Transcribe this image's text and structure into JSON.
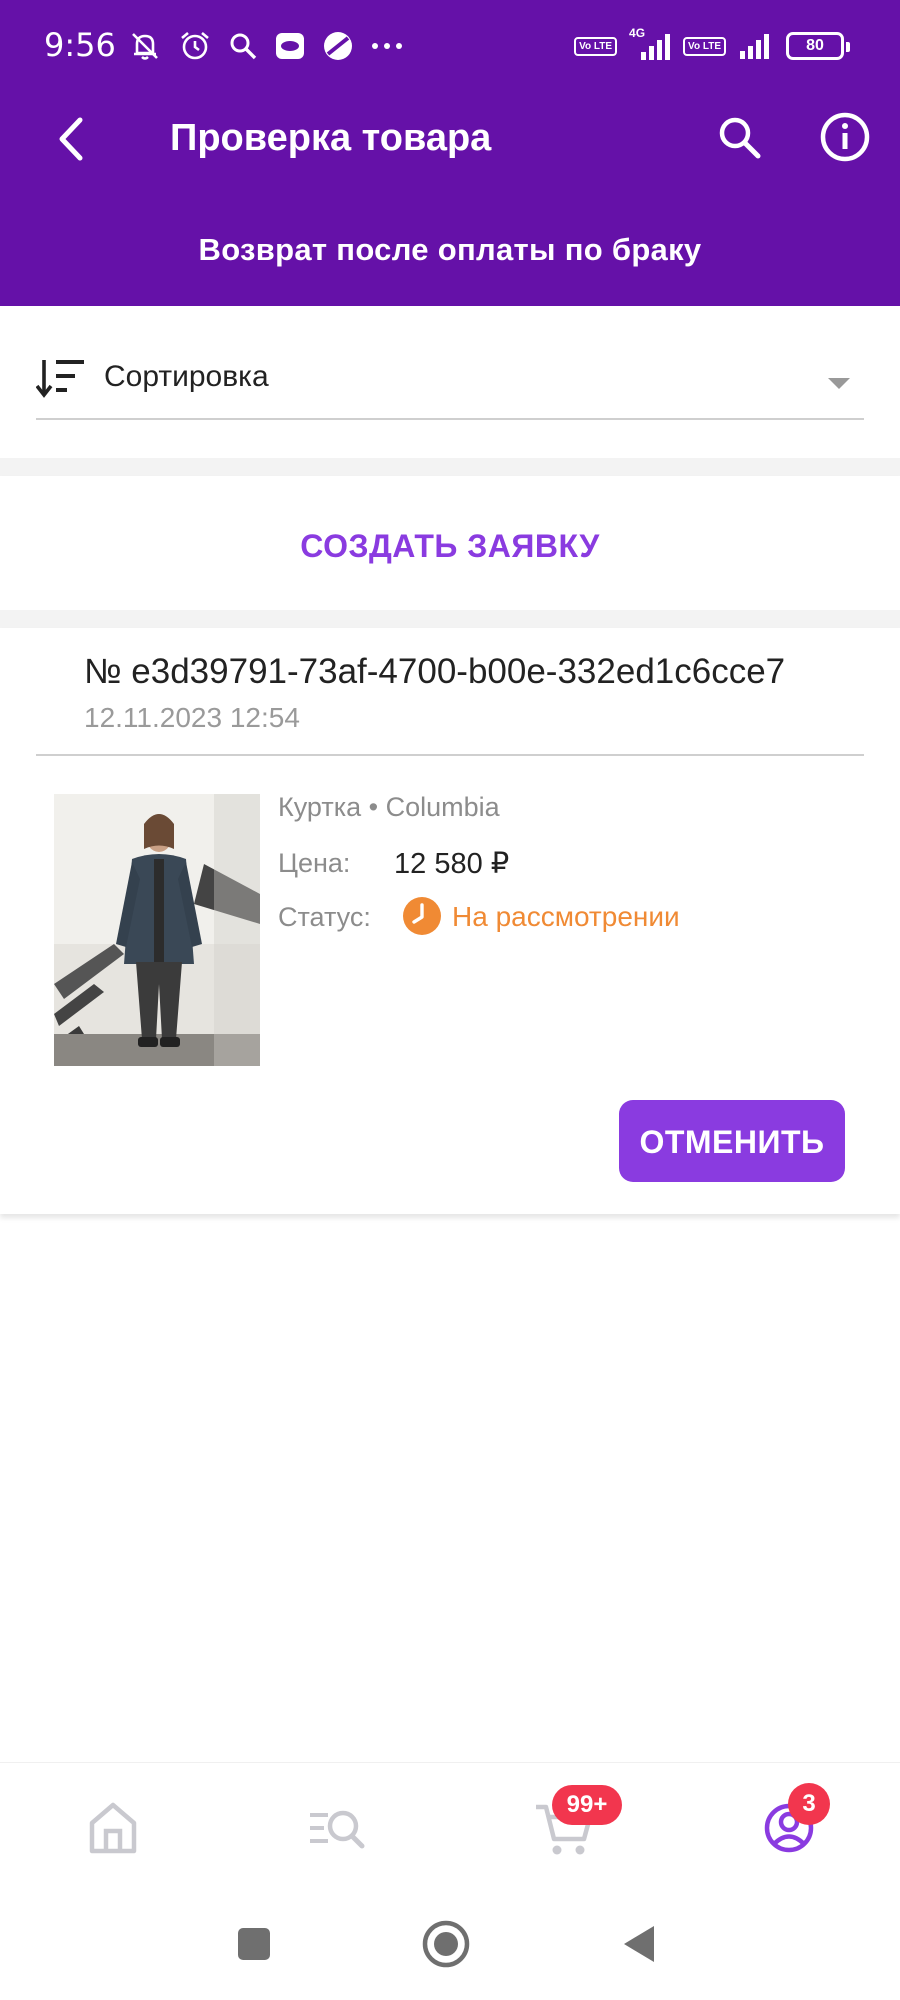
{
  "status_bar": {
    "time": "9:56",
    "left_icons": [
      "bell-off-icon",
      "alarm-icon",
      "search-icon",
      "app-icon",
      "app-icon-2",
      "more-icon"
    ],
    "network_1": "4G",
    "volte_label": "Vo LTE",
    "battery": "80"
  },
  "header": {
    "title": "Проверка товара",
    "subtitle": "Возврат после оплаты по браку",
    "background_color": "#6511a8"
  },
  "sort": {
    "label": "Сортировка"
  },
  "create_button": {
    "label": "СОЗДАТЬ ЗАЯВКУ"
  },
  "order": {
    "number": "№ e3d39791-73af-4700-b00e-332ed1c6cce7",
    "date": "12.11.2023 12:54",
    "product": {
      "category": "Куртка • Columbia",
      "price_label": "Цена:",
      "price": "12 580 ₽",
      "status_label": "Статус:",
      "status": "На рассмотрении",
      "status_color": "#f08a34"
    },
    "cancel_label": "ОТМЕНИТЬ"
  },
  "bottom_nav": {
    "items": [
      {
        "icon": "home-icon"
      },
      {
        "icon": "catalog-search-icon"
      },
      {
        "icon": "cart-icon",
        "badge": "99+"
      },
      {
        "icon": "profile-icon",
        "badge": "3"
      }
    ],
    "accent_color": "#8a3be0"
  },
  "system_nav": [
    "recent-apps-icon",
    "home-circle-icon",
    "back-triangle-icon"
  ]
}
